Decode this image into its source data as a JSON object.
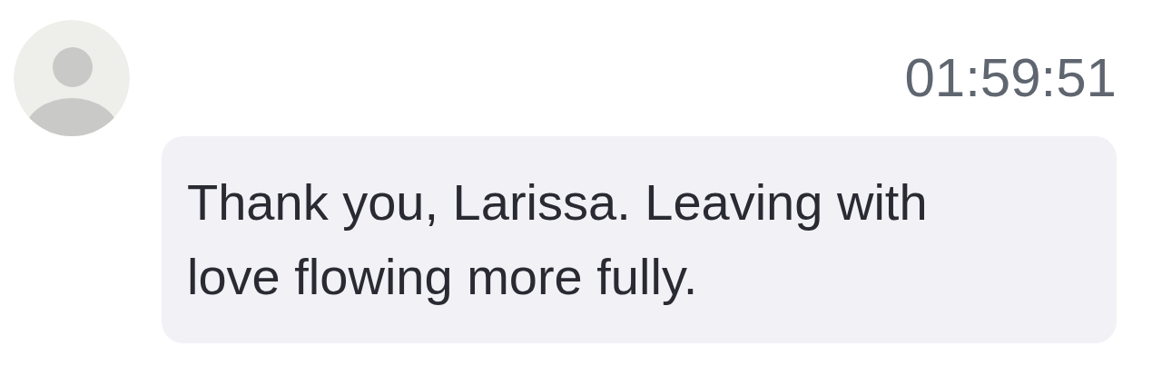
{
  "message": {
    "time": "01:59:51",
    "text": "Thank you, Larissa. Leaving with love flowing more fully."
  }
}
